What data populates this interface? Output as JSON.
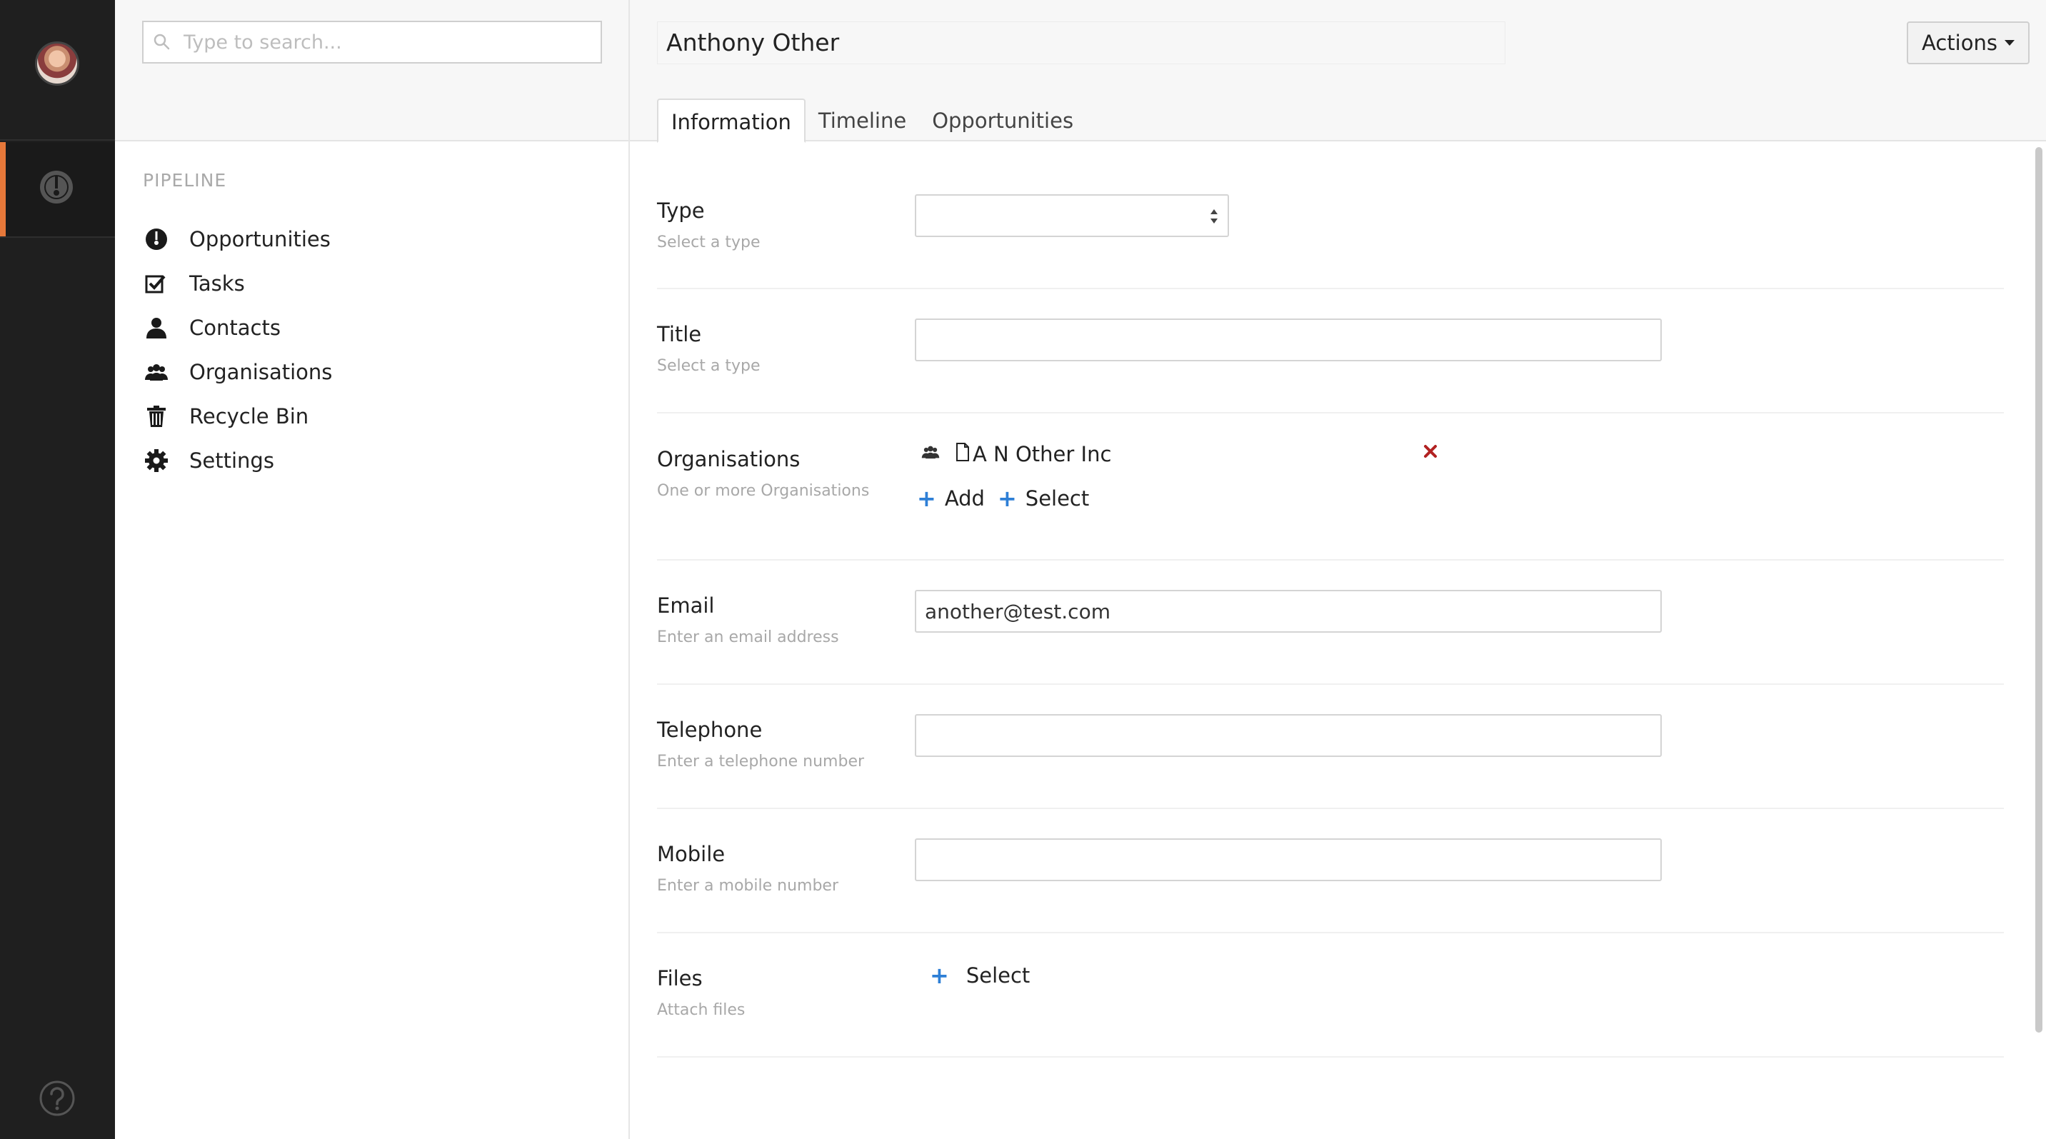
{
  "search": {
    "placeholder": "Type to search..."
  },
  "sidebar": {
    "section_label": "PIPELINE",
    "items": [
      {
        "label": "Opportunities",
        "icon": "gauge-icon"
      },
      {
        "label": "Tasks",
        "icon": "checkbox-icon"
      },
      {
        "label": "Contacts",
        "icon": "person-icon"
      },
      {
        "label": "Organisations",
        "icon": "group-icon"
      },
      {
        "label": "Recycle Bin",
        "icon": "trash-icon"
      },
      {
        "label": "Settings",
        "icon": "gear-icon"
      }
    ]
  },
  "header": {
    "record_name": "Anthony Other",
    "actions_label": "Actions"
  },
  "tabs": [
    {
      "label": "Information",
      "active": true
    },
    {
      "label": "Timeline",
      "active": false
    },
    {
      "label": "Opportunities",
      "active": false
    }
  ],
  "form": {
    "type": {
      "label": "Type",
      "hint": "Select a type",
      "value": ""
    },
    "title": {
      "label": "Title",
      "hint": "Select a type",
      "value": ""
    },
    "organisations": {
      "label": "Organisations",
      "hint": "One or more Organisations",
      "items": [
        {
          "name": "A N Other Inc"
        }
      ],
      "add_label": "Add",
      "select_label": "Select"
    },
    "email": {
      "label": "Email",
      "hint": "Enter an email address",
      "value": "another@test.com"
    },
    "telephone": {
      "label": "Telephone",
      "hint": "Enter a telephone number",
      "value": ""
    },
    "mobile": {
      "label": "Mobile",
      "hint": "Enter a mobile number",
      "value": ""
    },
    "files": {
      "label": "Files",
      "hint": "Attach files",
      "select_label": "Select"
    }
  },
  "colors": {
    "rail_bg": "#1f1f1f",
    "accent": "#e6783a",
    "link_blue": "#2e7fd6",
    "remove_red": "#b22222"
  }
}
